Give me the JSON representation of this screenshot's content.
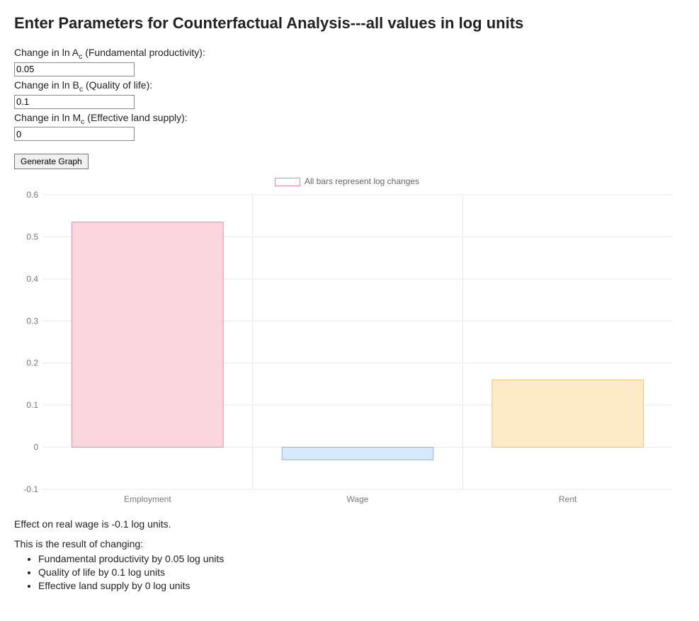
{
  "title": "Enter Parameters for Counterfactual Analysis---all values in log units",
  "params": {
    "a": {
      "label_pre": "Change in ln A",
      "label_sub": "c",
      "label_post": " (Fundamental productivity):",
      "value": "0.05"
    },
    "b": {
      "label_pre": "Change in ln B",
      "label_sub": "c",
      "label_post": " (Quality of life):",
      "value": "0.1"
    },
    "m": {
      "label_pre": "Change in ln M",
      "label_sub": "c",
      "label_post": " (Effective land supply):",
      "value": "0"
    }
  },
  "generate_label": "Generate Graph",
  "legend_text": "All bars represent log changes",
  "chart_data": {
    "type": "bar",
    "categories": [
      "Employment",
      "Wage",
      "Rent"
    ],
    "values": [
      0.535,
      -0.03,
      0.16
    ],
    "ylim": [
      -0.1,
      0.6
    ],
    "ticks": [
      "-0.1",
      "0",
      "0.1",
      "0.2",
      "0.3",
      "0.4",
      "0.5",
      "0.6"
    ],
    "tick_values": [
      -0.1,
      0,
      0.1,
      0.2,
      0.3,
      0.4,
      0.5,
      0.6
    ],
    "colors": {
      "Employment": {
        "fill": "#fbd6de",
        "stroke": "#e78aa0"
      },
      "Wage": {
        "fill": "#d6eafb",
        "stroke": "#8db9de"
      },
      "Rent": {
        "fill": "#fdebc8",
        "stroke": "#e8c478"
      }
    },
    "title": "",
    "xlabel": "",
    "ylabel": ""
  },
  "results": {
    "real_wage_line": "Effect on real wage is -0.1 log units.",
    "changing_line": "This is the result of changing:",
    "bullets": [
      "Fundamental productivity by 0.05 log units",
      "Quality of life by 0.1 log units",
      "Effective land supply by 0 log units"
    ]
  }
}
